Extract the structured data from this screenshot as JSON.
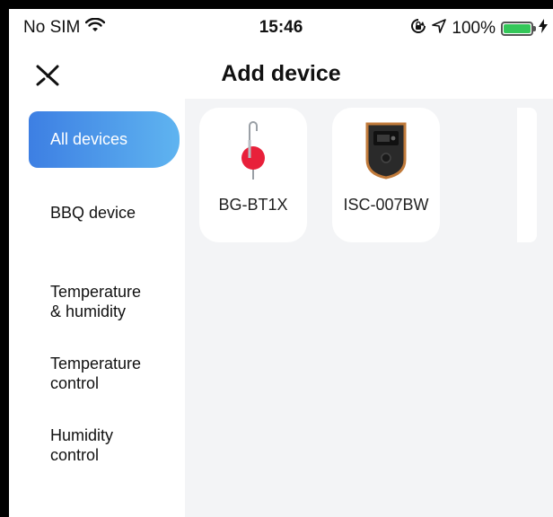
{
  "status_bar": {
    "carrier": "No SIM",
    "time": "15:46",
    "battery": "100%",
    "icons": [
      "wifi-icon",
      "orientation-lock-icon",
      "location-icon",
      "battery-icon",
      "charging-icon"
    ]
  },
  "header": {
    "title": "Add device",
    "close_icon": "close-icon"
  },
  "sidebar": {
    "items": [
      {
        "label": "All devices",
        "active": true
      },
      {
        "label": "BBQ device"
      },
      {
        "label": "Temperature\n& humidity"
      },
      {
        "label": "Temperature\ncontrol"
      },
      {
        "label": "Humidity\ncontrol"
      }
    ]
  },
  "devices": [
    {
      "name": "BG-BT1X",
      "icon": "probe-icon"
    },
    {
      "name": "ISC-007BW",
      "icon": "controller-icon"
    }
  ],
  "colors": {
    "active_gradient_start": "#3d7fe3",
    "active_gradient_end": "#5fb4f0",
    "content_bg": "#f3f4f6",
    "probe_red": "#e8203a"
  }
}
